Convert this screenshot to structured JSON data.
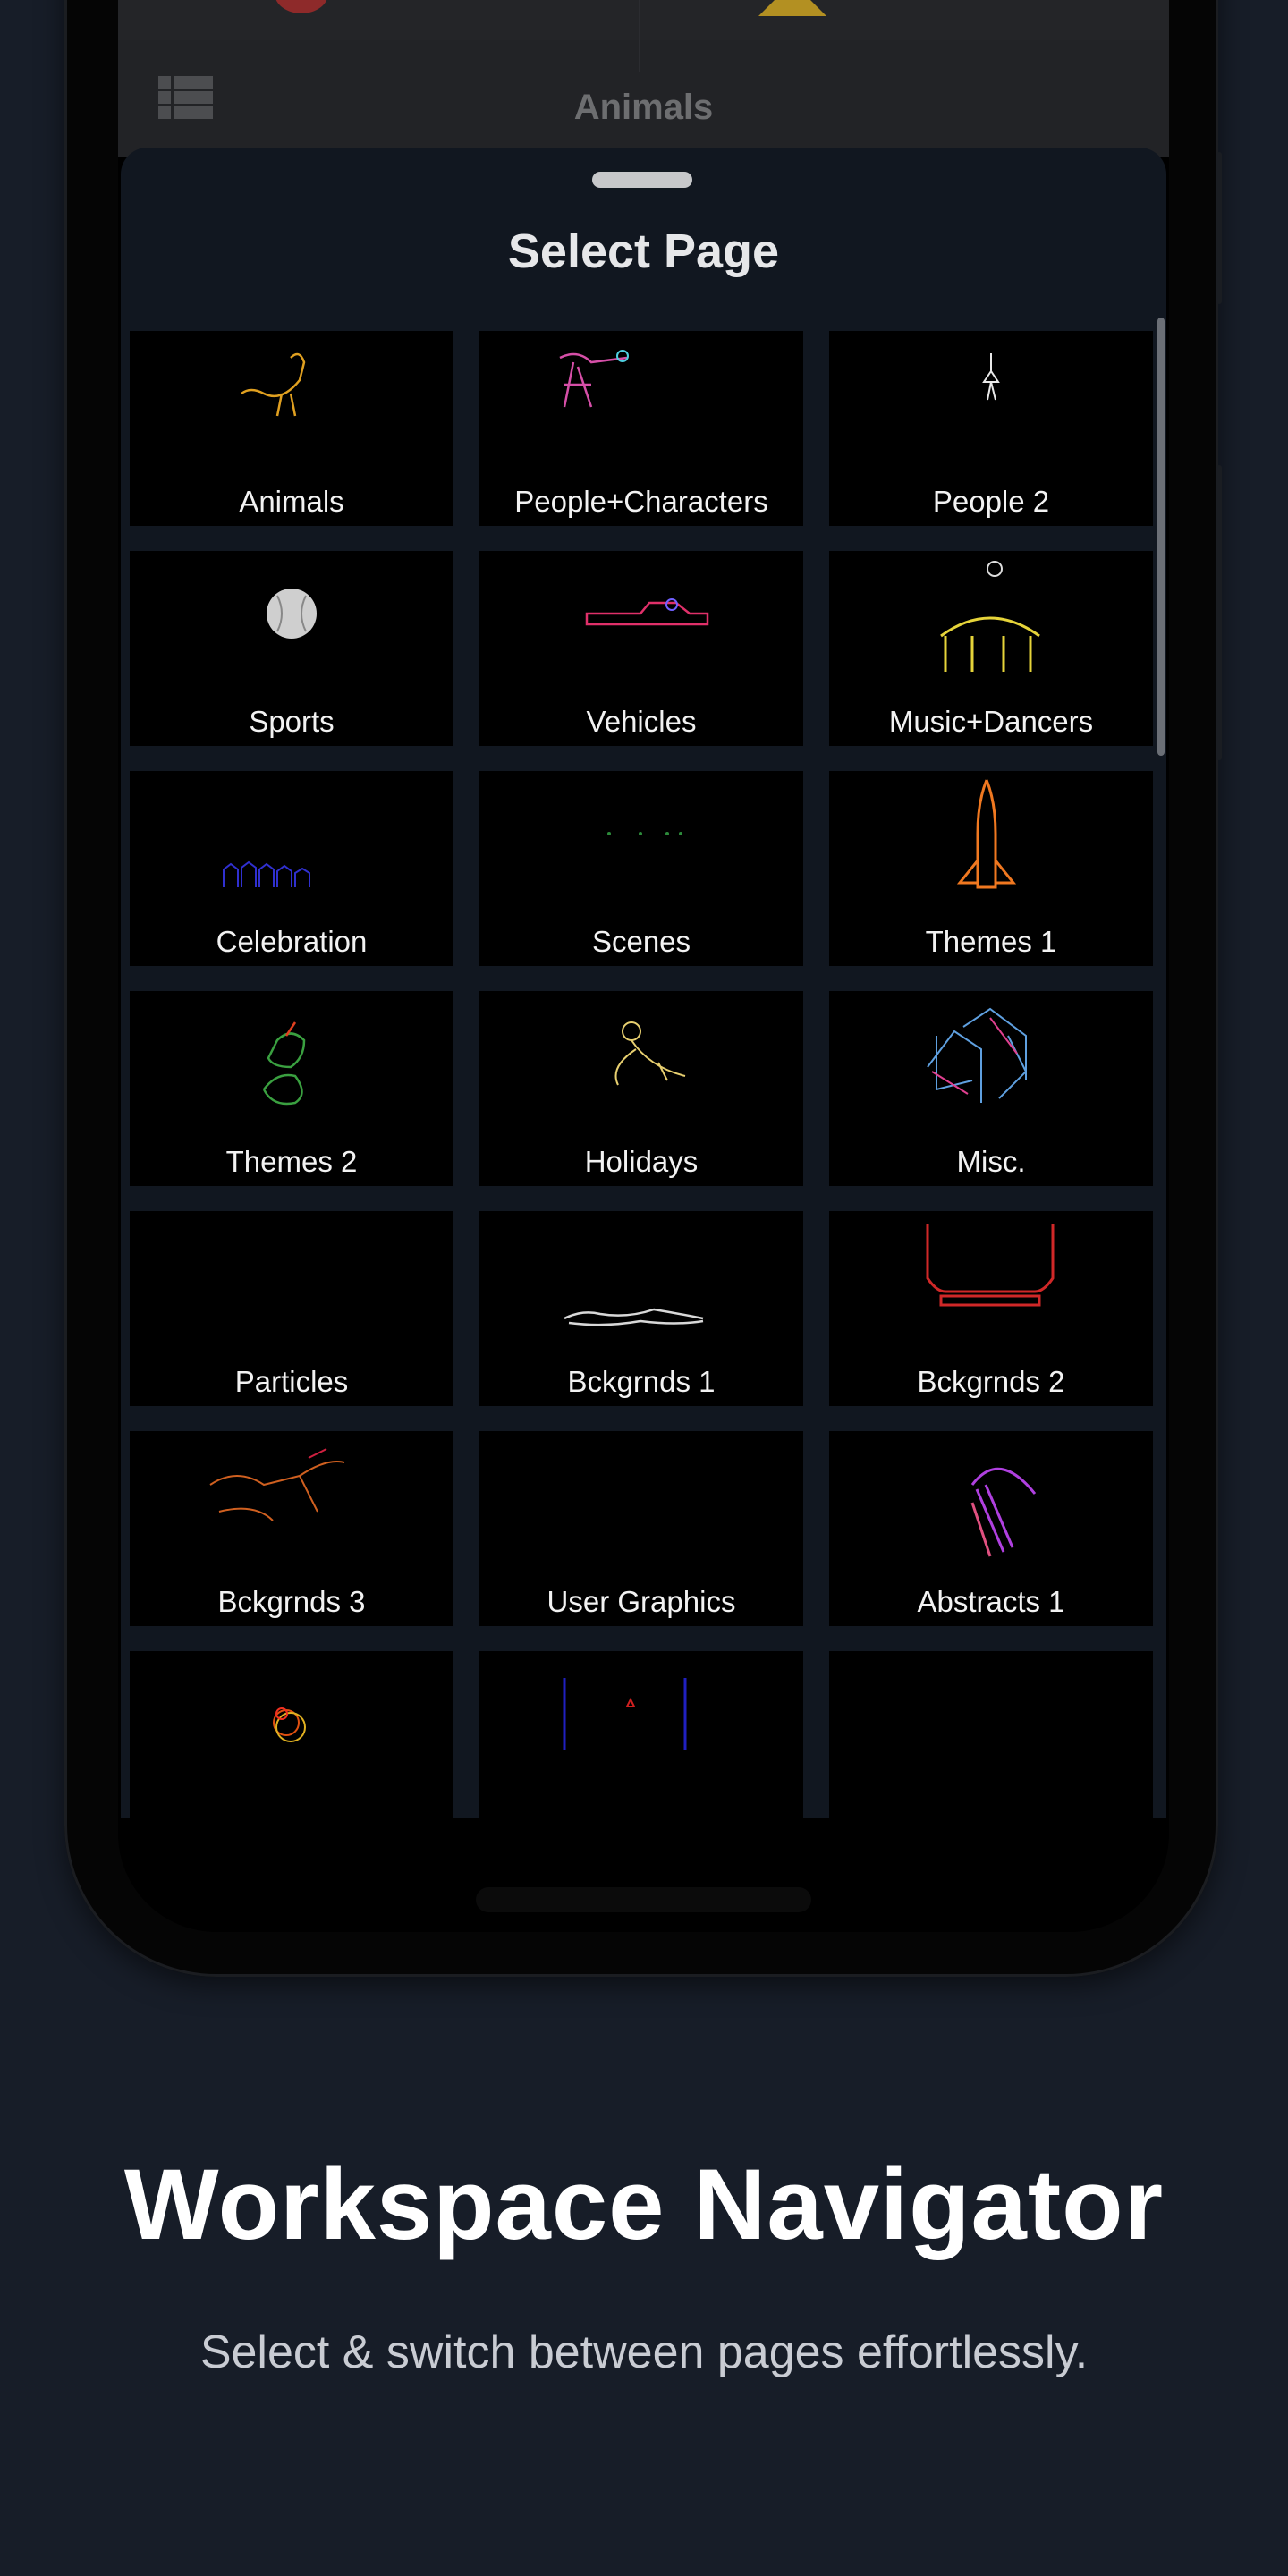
{
  "app_bar": {
    "title": "Animals",
    "menu_icon": "grid-list-icon"
  },
  "sheet": {
    "title": "Select Page",
    "tiles": [
      {
        "label": "Animals",
        "icon": "ostrich",
        "color": "#e0a020"
      },
      {
        "label": "People+Characters",
        "icon": "figure",
        "color": "#d64fa8"
      },
      {
        "label": "People 2",
        "icon": "ballerina",
        "color": "#e8e8e8"
      },
      {
        "label": "Sports",
        "icon": "baseball",
        "color": "#cfcfcf"
      },
      {
        "label": "Vehicles",
        "icon": "car",
        "color": "#e0306a"
      },
      {
        "label": "Music+Dancers",
        "icon": "drum",
        "color": "#e6d43a"
      },
      {
        "label": "Celebration",
        "icon": "crowd",
        "color": "#3030d0"
      },
      {
        "label": "Scenes",
        "icon": "dots",
        "color": "#2c8a3a"
      },
      {
        "label": "Themes 1",
        "icon": "rocket",
        "color": "#f07820"
      },
      {
        "label": "Themes 2",
        "icon": "bird",
        "color": "#3aa040"
      },
      {
        "label": "Holidays",
        "icon": "fairy",
        "color": "#e8d070"
      },
      {
        "label": "Misc.",
        "icon": "city",
        "color": "#5fa0e0"
      },
      {
        "label": "Particles",
        "icon": "none",
        "color": "#000000"
      },
      {
        "label": "Bckgrnds 1",
        "icon": "waves",
        "color": "#d8d8d8"
      },
      {
        "label": "Bckgrnds 2",
        "icon": "stage",
        "color": "#d02828"
      },
      {
        "label": "Bckgrnds 3",
        "icon": "dancer",
        "color": "#d06020"
      },
      {
        "label": "User Graphics",
        "icon": "none",
        "color": "#000000"
      },
      {
        "label": "Abstracts 1",
        "icon": "arc",
        "color": "#b040e0"
      },
      {
        "label": "",
        "icon": "rings",
        "color": "#e05010"
      },
      {
        "label": "",
        "icon": "bars",
        "color": "#2020c0"
      },
      {
        "label": "",
        "icon": "none",
        "color": "#000000"
      }
    ]
  },
  "marketing": {
    "headline": "Workspace Navigator",
    "subtitle": "Select & switch between pages effortlessly."
  }
}
